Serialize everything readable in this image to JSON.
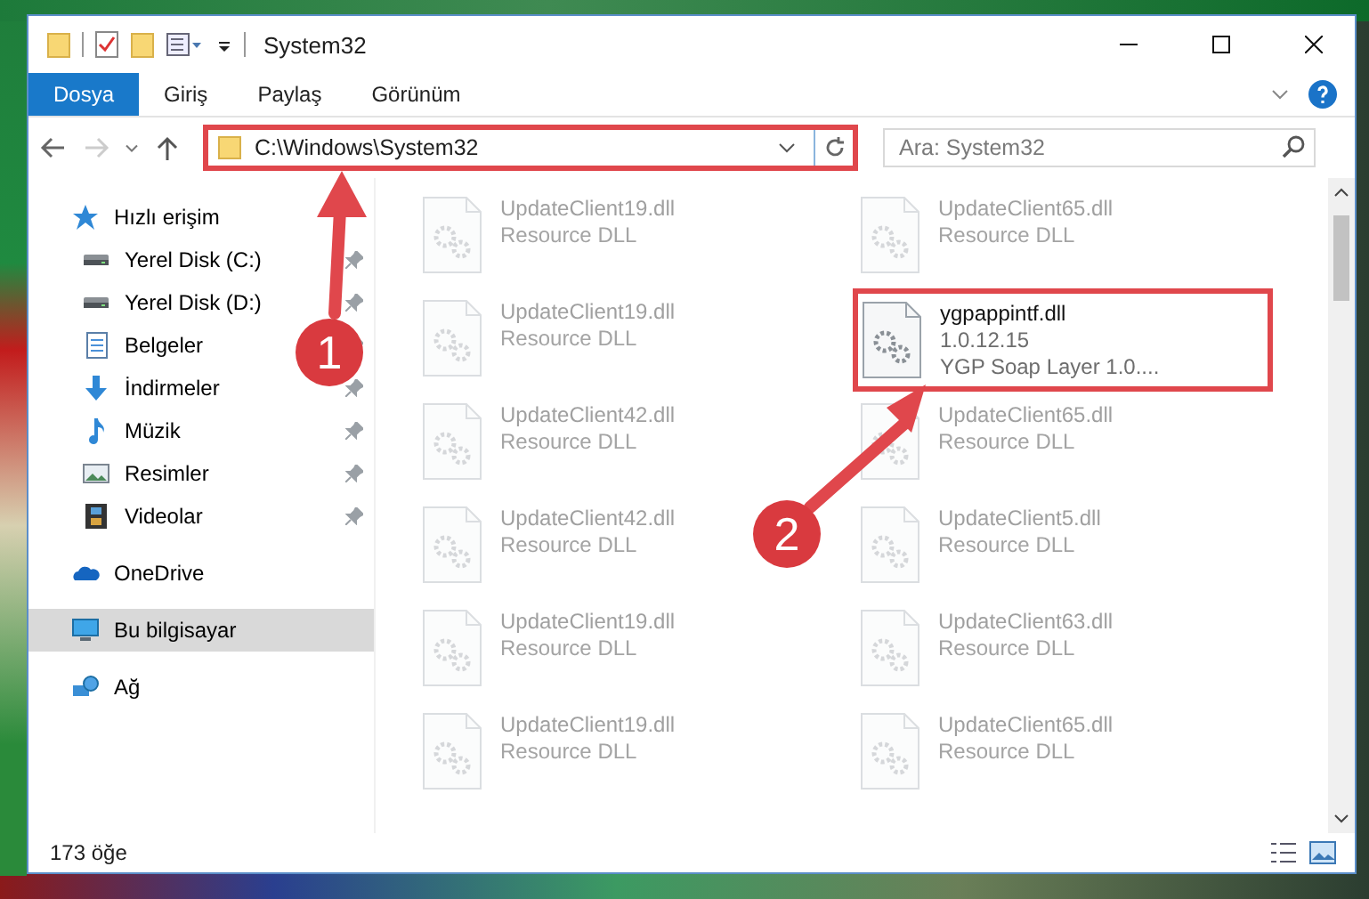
{
  "window": {
    "title": "System32"
  },
  "ribbon_tabs": [
    {
      "label": "Dosya",
      "selected": true
    },
    {
      "label": "Giriş",
      "selected": false
    },
    {
      "label": "Paylaş",
      "selected": false
    },
    {
      "label": "Görünüm",
      "selected": false
    }
  ],
  "address": {
    "path": "C:\\Windows\\System32",
    "highlighted": true
  },
  "search": {
    "placeholder": "Ara: System32"
  },
  "sidebar": {
    "items": [
      {
        "label": "Hızlı erişim",
        "kind": "star",
        "selected": false,
        "pinned": false,
        "children": [
          {
            "label": "Yerel Disk (C:)",
            "kind": "drive",
            "selected": false,
            "pinned": true
          },
          {
            "label": "Yerel Disk (D:)",
            "kind": "drive",
            "selected": false,
            "pinned": true
          },
          {
            "label": "Belgeler",
            "kind": "docs",
            "selected": false,
            "pinned": true
          },
          {
            "label": "İndirmeler",
            "kind": "download",
            "selected": false,
            "pinned": true
          },
          {
            "label": "Müzik",
            "kind": "music",
            "selected": false,
            "pinned": true
          },
          {
            "label": "Resimler",
            "kind": "pictures",
            "selected": false,
            "pinned": true
          },
          {
            "label": "Videolar",
            "kind": "videos",
            "selected": false,
            "pinned": true
          }
        ]
      },
      {
        "label": "OneDrive",
        "kind": "cloud",
        "selected": false,
        "pinned": false
      },
      {
        "label": "Bu bilgisayar",
        "kind": "computer",
        "selected": true,
        "pinned": false
      },
      {
        "label": "Ağ",
        "kind": "network",
        "selected": false,
        "pinned": false
      }
    ]
  },
  "files": [
    {
      "name": "UpdateClient19.dll",
      "details": [
        "Resource DLL"
      ],
      "blurred": true,
      "highlighted": false
    },
    {
      "name": "UpdateClient65.dll",
      "details": [
        "Resource DLL"
      ],
      "blurred": true,
      "highlighted": false
    },
    {
      "name": "UpdateClient19.dll",
      "details": [
        "Resource DLL"
      ],
      "blurred": true,
      "highlighted": false
    },
    {
      "name": "ygpappintf.dll",
      "details": [
        "1.0.12.15",
        "YGP Soap Layer 1.0...."
      ],
      "blurred": false,
      "highlighted": true
    },
    {
      "name": "UpdateClient42.dll",
      "details": [
        "Resource DLL"
      ],
      "blurred": true,
      "highlighted": false
    },
    {
      "name": "UpdateClient65.dll",
      "details": [
        "Resource DLL"
      ],
      "blurred": true,
      "highlighted": false
    },
    {
      "name": "UpdateClient42.dll",
      "details": [
        "Resource DLL"
      ],
      "blurred": true,
      "highlighted": false
    },
    {
      "name": "UpdateClient5.dll",
      "details": [
        "Resource DLL"
      ],
      "blurred": true,
      "highlighted": false
    },
    {
      "name": "UpdateClient19.dll",
      "details": [
        "Resource DLL"
      ],
      "blurred": true,
      "highlighted": false
    },
    {
      "name": "UpdateClient63.dll",
      "details": [
        "Resource DLL"
      ],
      "blurred": true,
      "highlighted": false
    },
    {
      "name": "UpdateClient19.dll",
      "details": [
        "Resource DLL"
      ],
      "blurred": true,
      "highlighted": false
    },
    {
      "name": "UpdateClient65.dll",
      "details": [
        "Resource DLL"
      ],
      "blurred": true,
      "highlighted": false
    }
  ],
  "status_bar": {
    "count": "173 öğe"
  },
  "annotations": [
    {
      "number": "1"
    },
    {
      "number": "2"
    }
  ]
}
